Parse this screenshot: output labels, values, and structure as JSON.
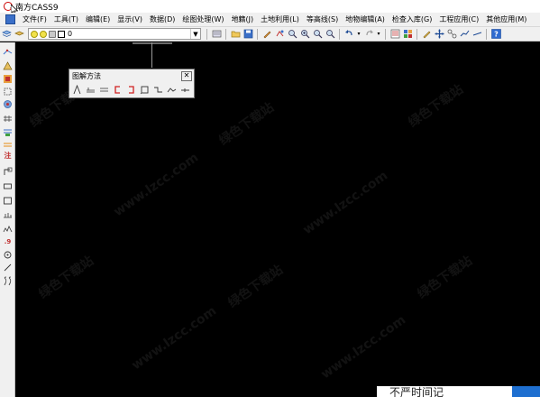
{
  "window": {
    "title": "南方CASS9"
  },
  "menubar": {
    "items": [
      "文件(F)",
      "工具(T)",
      "编辑(E)",
      "显示(V)",
      "数据(D)",
      "绘图处理(W)",
      "地籍(J)",
      "土地利用(L)",
      "等高线(S)",
      "地物编辑(A)",
      "检查入库(G)",
      "工程应用(C)",
      "其他应用(M)"
    ]
  },
  "toolbar": {
    "layer_value": "0"
  },
  "palette": {
    "title": "图解方法"
  },
  "bottom_popup": {
    "text": "不严时间记"
  },
  "watermark": {
    "text_cn": "绿色下载站",
    "text_url": "www.lzcc.com"
  },
  "colors": {
    "canvas": "#000000",
    "chrome": "#f0f0f0",
    "accent_blue": "#1e6fd0",
    "red_tool": "#d02020"
  }
}
